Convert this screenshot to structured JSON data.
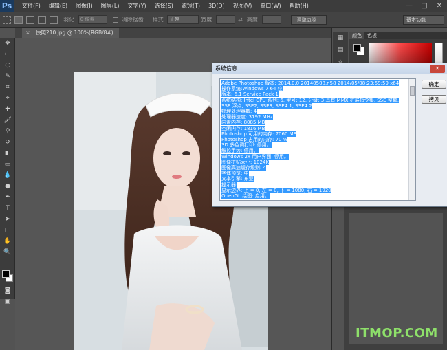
{
  "app": {
    "logo": "Ps"
  },
  "menubar": {
    "items": [
      "文件(F)",
      "编辑(E)",
      "图像(I)",
      "图层(L)",
      "文字(Y)",
      "选择(S)",
      "滤镜(T)",
      "3D(D)",
      "视图(V)",
      "窗口(W)",
      "帮助(H)"
    ],
    "window_controls": [
      "—",
      "□",
      "✕"
    ]
  },
  "options": {
    "feather_label": "羽化:",
    "feather_value": "0 像素",
    "antialias_label": "消除锯齿",
    "style_label": "样式:",
    "style_value": "正常",
    "width_label": "宽度:",
    "height_label": "高度:",
    "refine_edge_label": "调整边缘...",
    "workspace_value": "基本功能"
  },
  "document": {
    "tab_title": "快照210.jpg @ 100%(RGB/8#)",
    "close_glyph": "×"
  },
  "color_panel": {
    "tabs": [
      "颜色",
      "色板"
    ]
  },
  "dialog": {
    "title": "系统信息",
    "close_glyph": "✕",
    "ok_label": "确定",
    "copy_label": "拷贝",
    "lines": [
      "Adobe Photoshop 版本: 2014.0.0 20140508.r.58 2014/05/08:23:59:59  x64",
      "操作系统:Windows 7 64 位",
      "版本: 6.1 Service Pack 1",
      "系统结构: Intel CPU 系列: 6, 型号: 12, 分级: 3 具有 MMX 扩展指令集, SSE 整数,",
      "SSE 浮点, SSE2, SSE3, SSE4.1, SSE4.2",
      "物理处理器数: 4",
      "处理器速度: 3192 MHz",
      "内置内存: 8085 MB",
      "空闲内存: 1816 MB",
      "Photoshop 可用的内存: 7060 MB",
      "Photoshop 占用的内存: 70 %",
      "3D 多色调打印: 停用。",
      "触控手势: 停用。",
      "Windows 2x 用户界面: 停用。",
      "图像拼贴大小: 1024K",
      "图像高速缓存级别: 4",
      "字体预览: 中",
      "文本引擎: 东亚",
      "提示器:",
      "显示边界: 上 = 0, 左 = 0, 下 = 1080, 右 = 1920",
      "OpenGL 绘图: 启用。"
    ]
  },
  "watermark": {
    "text": "ITMOP.COM"
  }
}
